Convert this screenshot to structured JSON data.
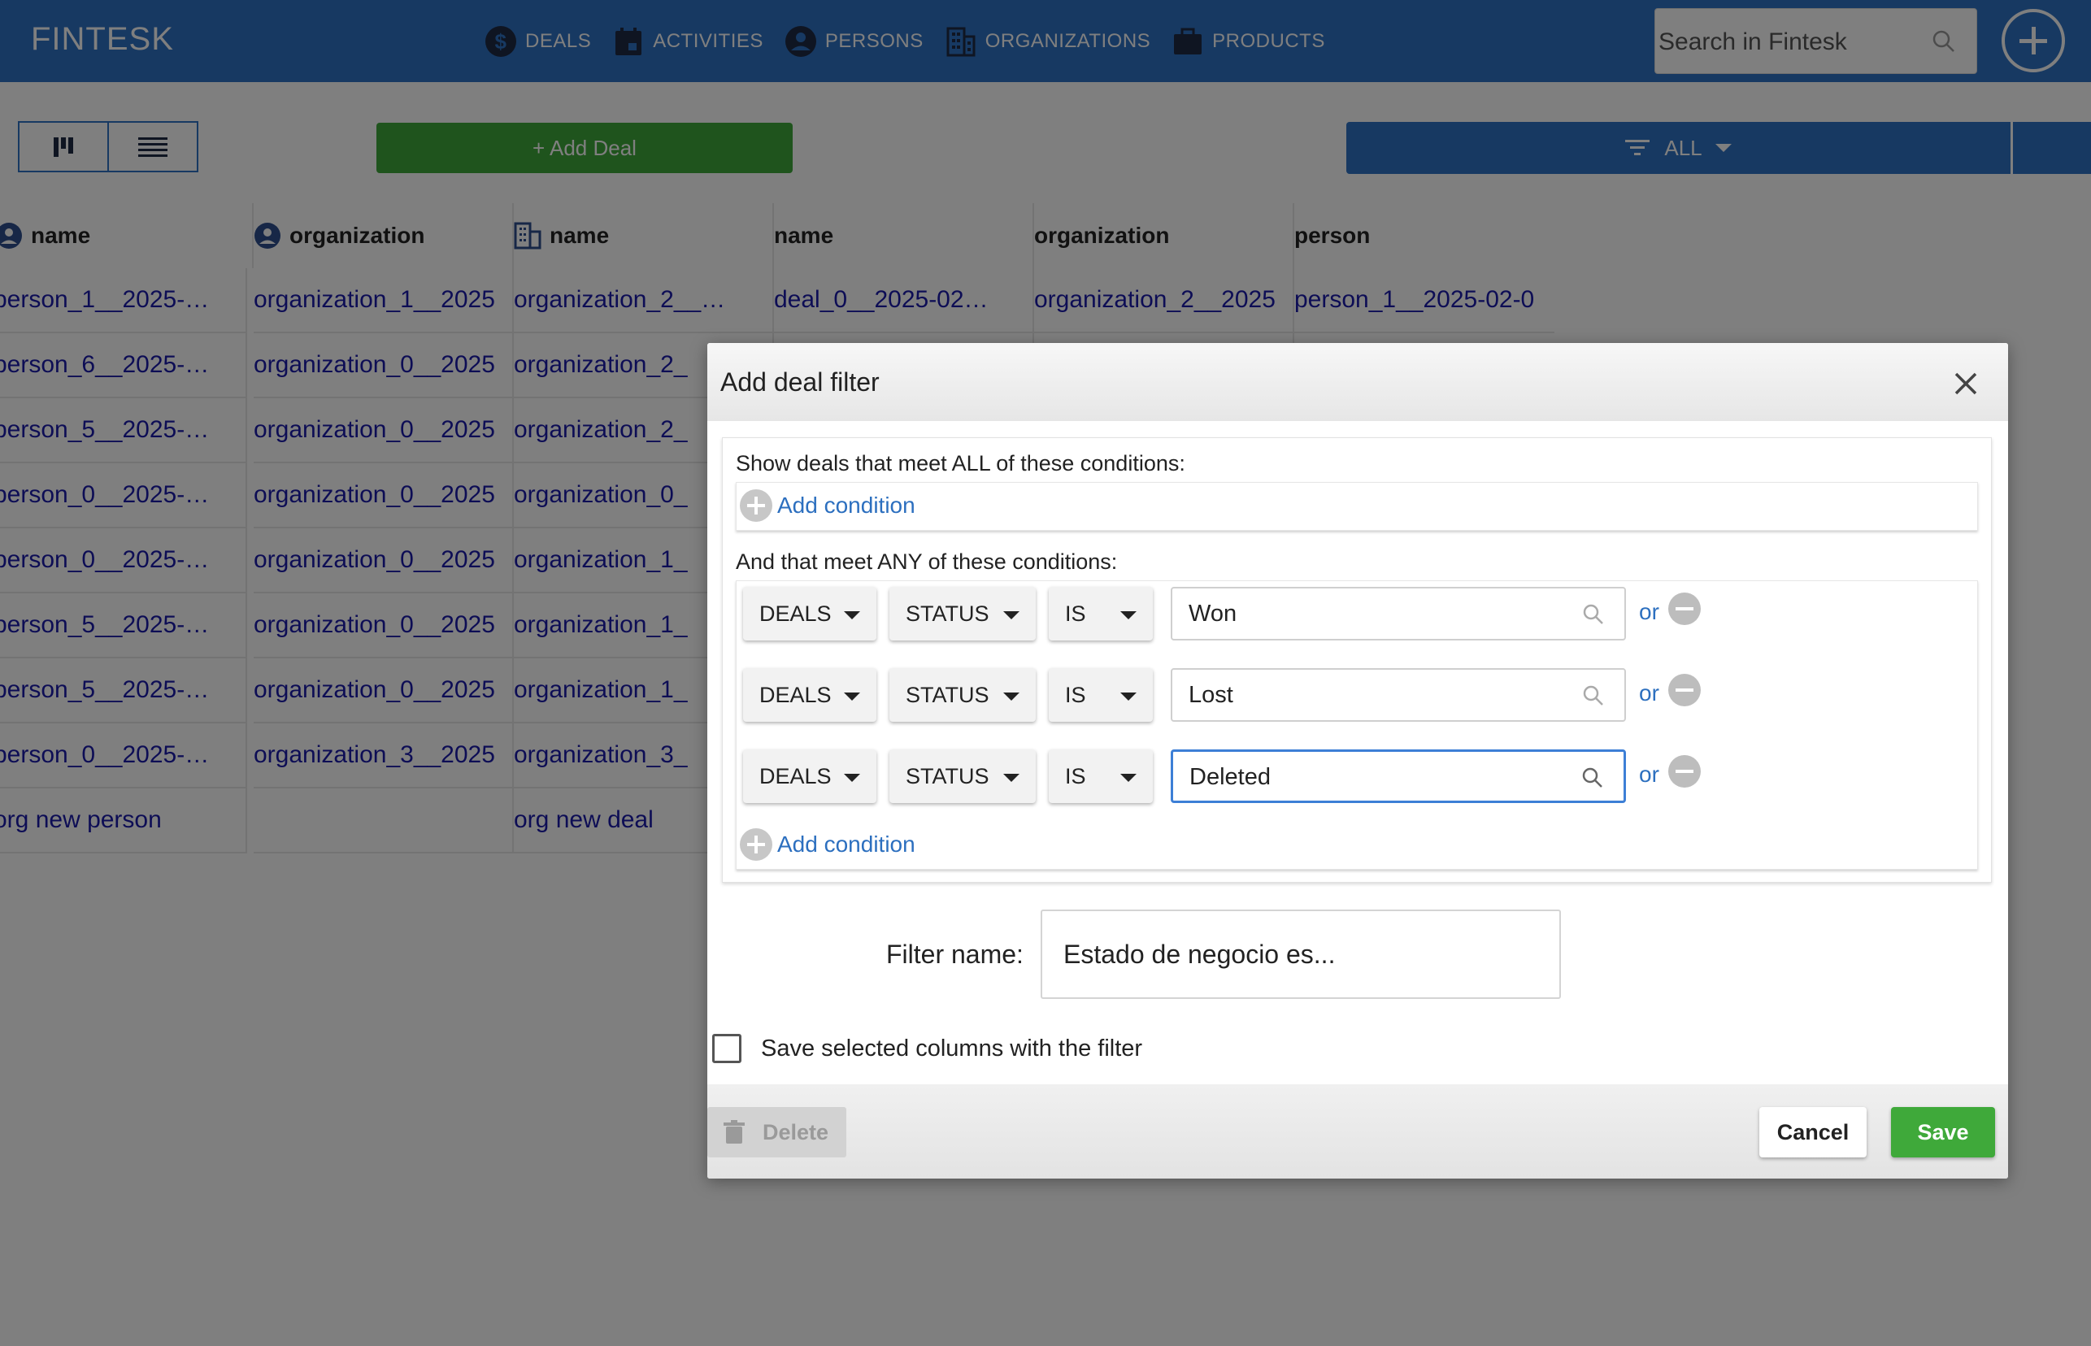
{
  "app": {
    "brand": "FINTESK"
  },
  "nav": [
    {
      "label": "DEALS",
      "icon": "dollar-circle-icon"
    },
    {
      "label": "ACTIVITIES",
      "icon": "calendar-icon"
    },
    {
      "label": "PERSONS",
      "icon": "person-circle-icon"
    },
    {
      "label": "ORGANIZATIONS",
      "icon": "building-icon"
    },
    {
      "label": "PRODUCTS",
      "icon": "briefcase-icon"
    }
  ],
  "search": {
    "placeholder": "Search in Fintesk",
    "value": ""
  },
  "toolbar": {
    "add_deal_label": "+ Add Deal",
    "filter_label": "ALL"
  },
  "table": {
    "columns": [
      "name",
      "organization",
      "name",
      "name",
      "organization",
      "person"
    ],
    "rows": [
      [
        "person_1__2025-…",
        "organization_1__2025",
        "organization_2__…",
        "deal_0__2025-02…",
        "organization_2__2025",
        "person_1__2025-02-0"
      ],
      [
        "person_6__2025-…",
        "organization_0__2025",
        "organization_2_",
        "",
        "",
        ""
      ],
      [
        "person_5__2025-…",
        "organization_0__2025",
        "organization_2_",
        "",
        "",
        ""
      ],
      [
        "person_0__2025-…",
        "organization_0__2025",
        "organization_0_",
        "",
        "",
        ""
      ],
      [
        "person_0__2025-…",
        "organization_0__2025",
        "organization_1_",
        "",
        "",
        ""
      ],
      [
        "person_5__2025-…",
        "organization_0__2025",
        "organization_1_",
        "",
        "",
        ""
      ],
      [
        "person_5__2025-…",
        "organization_0__2025",
        "organization_1_",
        "",
        "",
        ""
      ],
      [
        "person_0__2025-…",
        "organization_3__2025",
        "organization_3_",
        "",
        "",
        ""
      ],
      [
        "org new person",
        "",
        "org new deal",
        "",
        "",
        ""
      ]
    ]
  },
  "dialog": {
    "title": "Add deal filter",
    "all_label": "Show deals that meet ALL of these conditions:",
    "any_label": "And that meet ANY of these conditions:",
    "add_condition_label": "Add condition",
    "conditions": [
      {
        "entity": "DEALS",
        "field": "STATUS",
        "operator": "IS",
        "value": "Won",
        "or_label": "or"
      },
      {
        "entity": "DEALS",
        "field": "STATUS",
        "operator": "IS",
        "value": "Lost",
        "or_label": "or"
      },
      {
        "entity": "DEALS",
        "field": "STATUS",
        "operator": "IS",
        "value": "Deleted",
        "or_label": "or"
      }
    ],
    "filter_name_label": "Filter name:",
    "filter_name_value": "Estado de negocio es...",
    "save_columns_label": "Save selected columns with the filter",
    "save_columns_checked": false,
    "delete_label": "Delete",
    "cancel_label": "Cancel",
    "save_label": "Save"
  },
  "colors": {
    "primary": "#2f72c4",
    "success": "#3fa93a",
    "link": "#2c6fbf",
    "cell_text": "#1a1aaa"
  }
}
